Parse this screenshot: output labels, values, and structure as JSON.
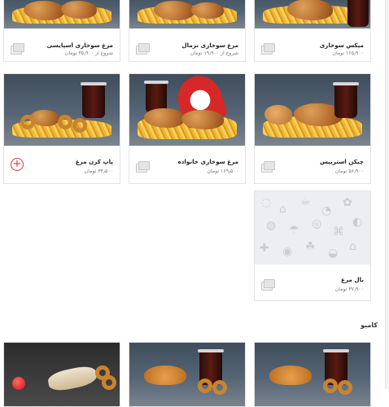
{
  "currency": "تومان",
  "row1": [
    {
      "title": "میکس سوخاری",
      "price": "۱۶۵٫۹۰۰ تومان"
    },
    {
      "title": "مرغ سوخاری نرمال",
      "price": "شروع از ۱۹٫۹۰۰ تومان"
    },
    {
      "title": "مرغ سوخاری اسپایسی",
      "price": "شروع از ۳۵٫۹۰۰ تومان"
    }
  ],
  "row2": [
    {
      "title": "چیکن استریپس",
      "price": "۵۶٫۹۰۰ تومان"
    },
    {
      "title": "مرغ سوخاری خانواده",
      "price": "۱۶۹٫۵۰۰ تومان"
    },
    {
      "title": "پاپ کرن مرغ",
      "price": "۳۴٫۵۰۰ تومان",
      "add_icon": "plus-circle-icon"
    }
  ],
  "row3": [
    {
      "title": "بال مرغ",
      "price": "۳۷٫۹۰۰ تومان"
    }
  ],
  "section": {
    "combo_title": "کامبو"
  },
  "colors": {
    "accent": "#d83a3a",
    "border": "#e3e3e3"
  }
}
